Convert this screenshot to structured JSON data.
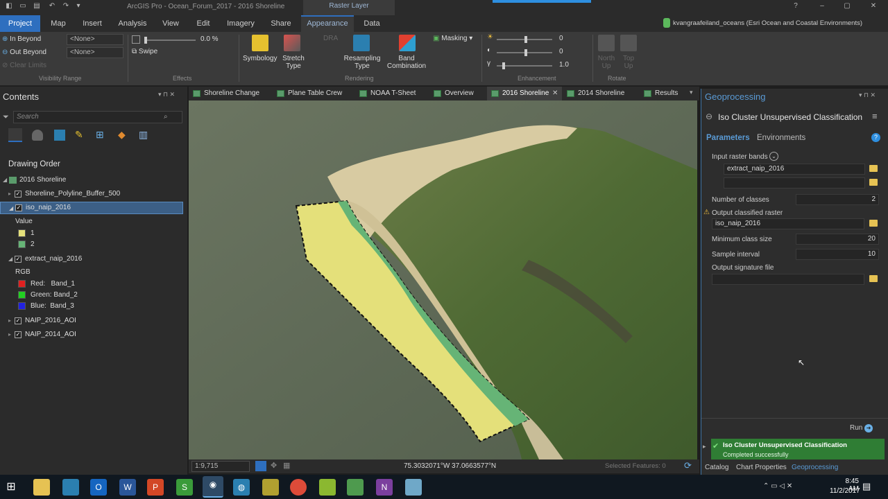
{
  "titlebar": {
    "app": "ArcGIS Pro",
    "project": "Ocean_Forum_2017",
    "map": "2016 Shoreline",
    "context_tab": "Raster Layer",
    "help": "?"
  },
  "tabs": [
    "Project",
    "Map",
    "Insert",
    "Analysis",
    "View",
    "Edit",
    "Imagery",
    "Share",
    "Appearance",
    "Data"
  ],
  "user": "kvangraafeiland_oceans (Esri Ocean and Coastal Environments)",
  "ribbon": {
    "in_beyond": "In Beyond",
    "out_beyond": "Out Beyond",
    "clear_limits": "Clear Limits",
    "in_beyond_value": "<None>",
    "out_beyond_value": "<None>",
    "visibility_range": "Visibility Range",
    "transparency": "0.0 %",
    "swipe": "Swipe",
    "effects": "Effects",
    "dra": "DRA",
    "symbology": "Symbology",
    "stretch_type": "Stretch Type",
    "resampling_type": "Resampling Type",
    "band_combination": "Band Combination",
    "masking": "Masking",
    "rendering": "Rendering",
    "brightness": "0",
    "contrast": "0",
    "gamma": "1.0",
    "enhancement": "Enhancement",
    "north_up": "North Up",
    "top_up": "Top Up",
    "rotate": "Rotate"
  },
  "contents": {
    "title": "Contents",
    "search_placeholder": "Search",
    "drawing_order": "Drawing Order",
    "map": "2016 Shoreline",
    "layers": [
      {
        "name": "Shoreline_Polyline_Buffer_500"
      },
      {
        "name": "iso_naip_2016"
      },
      {
        "name": "extract_naip_2016"
      },
      {
        "name": "NAIP_2016_AOI"
      },
      {
        "name": "NAIP_2014_AOI"
      }
    ],
    "iso_value_label": "Value",
    "iso_classes": [
      {
        "label": "1",
        "color": "#e4e07a"
      },
      {
        "label": "2",
        "color": "#66b476"
      }
    ],
    "rgb_label": "RGB",
    "rgb_bands": [
      {
        "label": "Red:   Band_1",
        "color": "#e02020"
      },
      {
        "label": "Green: Band_2",
        "color": "#22d022"
      },
      {
        "label": "Blue:  Band_3",
        "color": "#2222e0"
      }
    ]
  },
  "map_tabs": [
    "Shoreline Change",
    "Plane Table Crew",
    "NOAA T-Sheet",
    "Overview",
    "2016 Shoreline",
    "2014 Shoreline",
    "Results"
  ],
  "status": {
    "scale": "1:9,715",
    "coordinates": "75.3032071°W 37.0663577°N",
    "selected": "Selected Features: 0"
  },
  "geoprocessing": {
    "panel_title": "Geoprocessing",
    "tool": "Iso Cluster Unsupervised Classification",
    "parameters": "Parameters",
    "environments": "Environments",
    "input_raster_bands": "Input raster bands",
    "input_value": "extract_naip_2016",
    "number_of_classes": "Number of classes",
    "classes_value": "2",
    "output_classified_raster": "Output classified raster",
    "output_value": "iso_naip_2016",
    "minimum_class_size": "Minimum class size",
    "min_value": "20",
    "sample_interval": "Sample interval",
    "sample_value": "10",
    "output_signature_file": "Output signature file",
    "run": "Run",
    "result_title": "Iso Cluster Unsupervised Classification",
    "result_status": "Completed successfully",
    "bottom_tabs": [
      "Catalog",
      "Chart Properties",
      "Geoprocessing"
    ]
  },
  "taskbar": {
    "time": "8:45 AM",
    "date": "11/2/2017"
  },
  "colors": {
    "accent": "#2e6fbf",
    "class1": "#e4e07a",
    "class2": "#66b476",
    "success": "#2f7d34"
  }
}
